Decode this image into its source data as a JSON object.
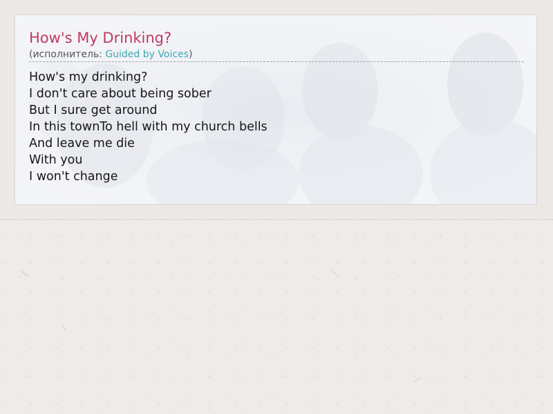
{
  "song": {
    "title": "How's My Drinking?",
    "artist_prefix": "(исполнитель: ",
    "artist_name": "Guided by Voices",
    "artist_suffix": ")"
  },
  "lyrics": [
    "How's my drinking?",
    "I don't care about being sober",
    "But I sure get around",
    "In this townTo hell with my church bells",
    "And leave me die",
    "With you",
    "I won't change"
  ],
  "colors": {
    "title": "#c0395f",
    "artist_link": "#3fa7b4",
    "page_background": "#efebe8"
  }
}
